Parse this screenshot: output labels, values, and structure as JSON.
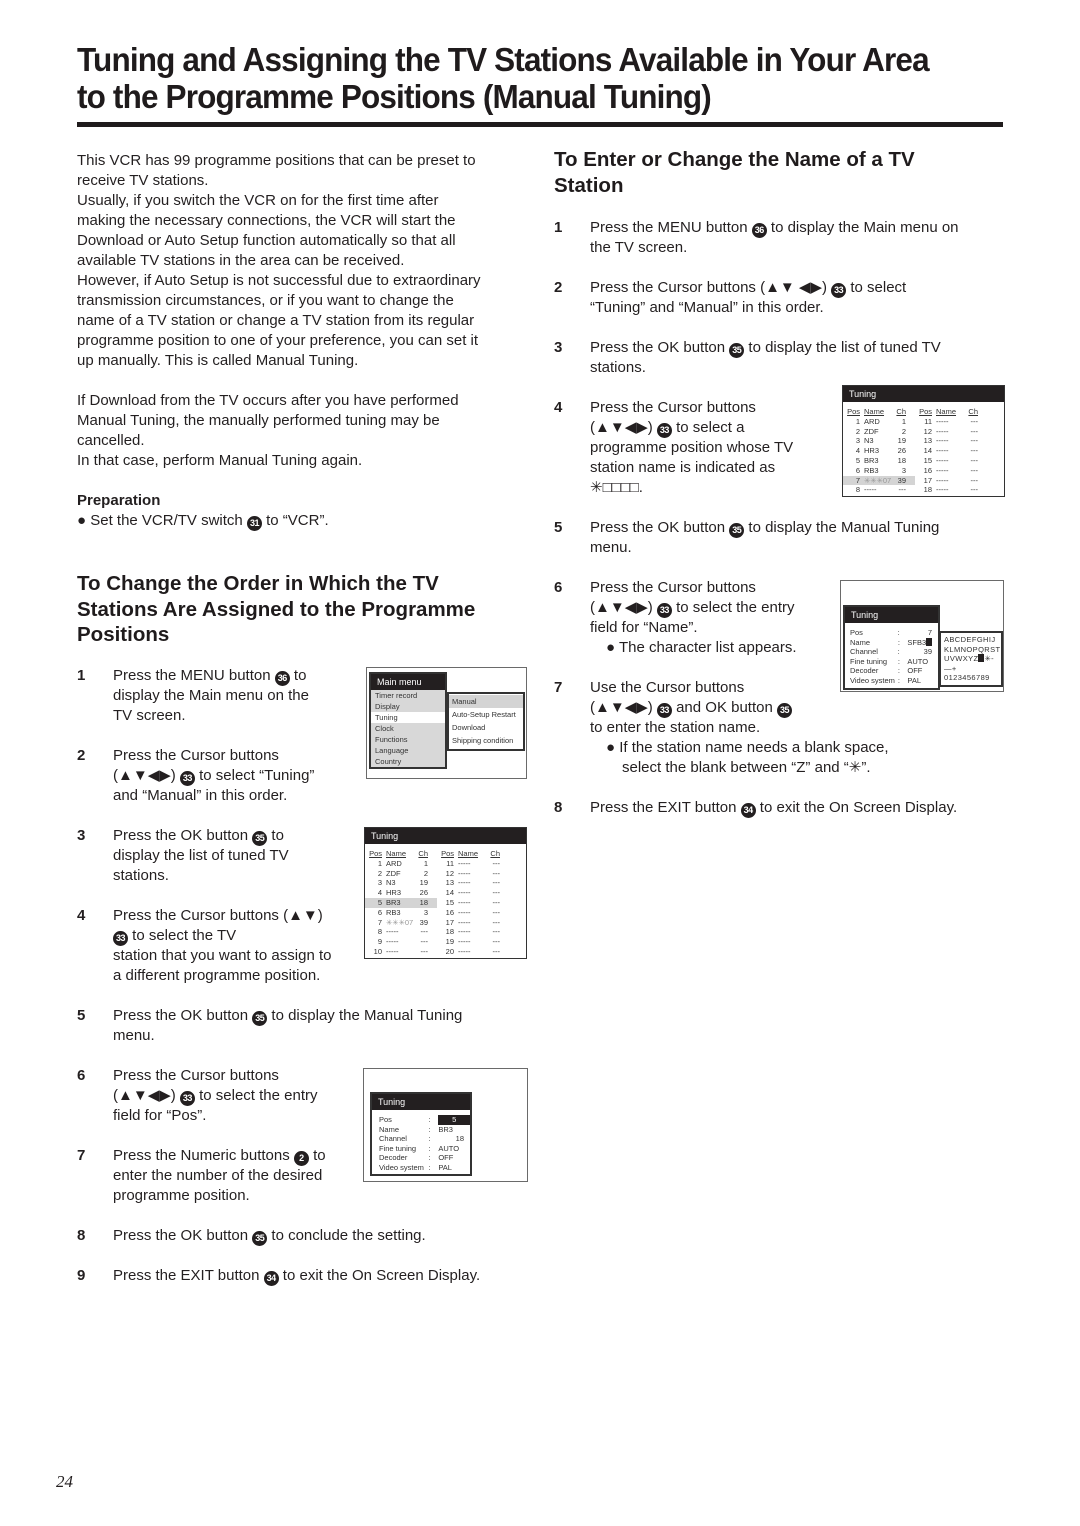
{
  "title": {
    "line1": "Tuning and Assigning the TV Stations Available in Your Area",
    "line2": "to the Programme Positions (Manual Tuning)"
  },
  "intro": {
    "p1_lines": [
      "This VCR has 99 programme positions that can be preset to",
      "receive TV stations.",
      "Usually, if you switch the VCR on for the first time after",
      "making the necessary connections, the VCR will start the",
      "Download or Auto Setup function automatically so that all",
      "available TV stations in the area can be received.",
      "However, if Auto Setup is not successful due to extraordinary",
      "transmission circumstances, or if you want to change the",
      "name of a TV station or change a TV station from its regular",
      "programme position to one of your preference, you can set it",
      "up manually. This is called Manual Tuning."
    ],
    "p2_lines": [
      "If Download from the TV occurs after you have performed",
      "Manual Tuning, the manually performed tuning may be",
      "cancelled.",
      "In that case, perform Manual Tuning again."
    ],
    "preparation_heading": "Preparation",
    "preparation_bullet_pre": "● Set the VCR/TV switch ",
    "preparation_badge": "31",
    "preparation_bullet_post": " to “VCR”."
  },
  "section_order": {
    "heading_lines": [
      "To Change the Order in Which the TV",
      "Stations Are Assigned to the Programme",
      "Positions"
    ],
    "steps": [
      {
        "num": "1",
        "lines": [
          "Press the MENU button ⑯ to",
          "display the Main menu on the",
          "TV screen."
        ]
      },
      {
        "num": "2",
        "lines": [
          "Press the Cursor buttons",
          "(▲▼◀▶) ⑬ to select “Tuning”",
          "and “Manual” in this order."
        ]
      },
      {
        "num": "3",
        "lines": [
          "Press the OK button ⑮ to",
          "display the list of tuned TV",
          "stations."
        ]
      },
      {
        "num": "4",
        "lines": [
          "Press the Cursor buttons (▲▼)",
          "⑬ to select the TV",
          "station that you want to assign to",
          "a different programme position."
        ]
      },
      {
        "num": "5",
        "lines": [
          "Press the OK button ⑮ to display the Manual Tuning",
          "menu."
        ]
      },
      {
        "num": "6",
        "lines": [
          "Press the Cursor buttons",
          "(▲▼◀▶) ⑬ to select the entry",
          "field for “Pos”."
        ]
      },
      {
        "num": "7",
        "lines": [
          "Press the Numeric buttons ❷ to",
          "enter the number of the desired",
          "programme position."
        ]
      },
      {
        "num": "8",
        "lines": [
          "Press the OK button ⑮ to conclude the setting."
        ]
      },
      {
        "num": "9",
        "lines": [
          "Press the EXIT button ⑭ to exit the On Screen Display."
        ]
      }
    ],
    "badges": {
      "menu": "36",
      "cursor": "33",
      "ok": "35",
      "exit": "34",
      "numeric": "2"
    }
  },
  "section_name": {
    "heading_lines": [
      "To Enter or Change the Name of a TV",
      "Station"
    ],
    "steps": [
      {
        "num": "1",
        "lines": [
          "Press the MENU button ⑯ to display the Main menu on",
          "the TV screen."
        ]
      },
      {
        "num": "2",
        "lines": [
          "Press the Cursor buttons (▲▼ ◀▶) ⑬ to select",
          "“Tuning” and “Manual” in this order."
        ]
      },
      {
        "num": "3",
        "lines": [
          "Press the OK button ⑮ to display the list of tuned TV",
          "stations."
        ]
      },
      {
        "num": "4",
        "lines": [
          "Press the Cursor buttons",
          "(▲▼◀▶) ⑬ to select a",
          "programme position whose TV",
          "station name is indicated as",
          "✳□□□□."
        ]
      },
      {
        "num": "5",
        "lines": [
          "Press the OK button ⑮ to display the Manual Tuning",
          "menu."
        ]
      },
      {
        "num": "6",
        "lines": [
          "Press the Cursor buttons",
          "(▲▼◀▶) ⑬ to select the entry",
          "field for “Name”."
        ],
        "bullet": "● The character list appears."
      },
      {
        "num": "7",
        "lines": [
          "Use the Cursor buttons",
          "(▲▼◀▶) ⑬ and OK button ⑮",
          "to enter the station name."
        ],
        "bullet_lines": [
          "● If the station name needs a blank space,",
          "select the blank between “Z” and “✳”."
        ]
      },
      {
        "num": "8",
        "lines": [
          "Press the EXIT button ⑭ to exit the On Screen Display."
        ]
      }
    ]
  },
  "osd_main_menu": {
    "header": "Main menu",
    "items": [
      "Timer record",
      "Display",
      "Tuning",
      "Clock",
      "Functions",
      "Language",
      "Country"
    ],
    "selected": "Tuning",
    "submenu": [
      "Manual",
      "Auto-Setup Restart",
      "Download",
      "Shipping condition"
    ],
    "submenu_selected": "Manual"
  },
  "osd_station_list": {
    "header": "Tuning",
    "columns": [
      "Pos",
      "Name",
      "Ch",
      "Pos",
      "Name",
      "Ch"
    ],
    "rows_left": [
      {
        "pos": "1",
        "name": "ARD",
        "ch": "1"
      },
      {
        "pos": "2",
        "name": "ZDF",
        "ch": "2"
      },
      {
        "pos": "3",
        "name": "N3",
        "ch": "19"
      },
      {
        "pos": "4",
        "name": "HR3",
        "ch": "26"
      },
      {
        "pos": "5",
        "name": "BR3",
        "ch": "18"
      },
      {
        "pos": "6",
        "name": "RB3",
        "ch": "3"
      },
      {
        "pos": "7",
        "name": "✳✳✳07",
        "ch": "39"
      },
      {
        "pos": "8",
        "name": "-----",
        "ch": "---"
      },
      {
        "pos": "9",
        "name": "-----",
        "ch": "---"
      },
      {
        "pos": "10",
        "name": "-----",
        "ch": "---"
      }
    ],
    "rows_right": [
      {
        "pos": "11",
        "name": "-----",
        "ch": "---"
      },
      {
        "pos": "12",
        "name": "-----",
        "ch": "---"
      },
      {
        "pos": "13",
        "name": "-----",
        "ch": "---"
      },
      {
        "pos": "14",
        "name": "-----",
        "ch": "---"
      },
      {
        "pos": "15",
        "name": "-----",
        "ch": "---"
      },
      {
        "pos": "16",
        "name": "-----",
        "ch": "---"
      },
      {
        "pos": "17",
        "name": "-----",
        "ch": "---"
      },
      {
        "pos": "18",
        "name": "-----",
        "ch": "---"
      },
      {
        "pos": "19",
        "name": "-----",
        "ch": "---"
      },
      {
        "pos": "20",
        "name": "-----",
        "ch": "---"
      }
    ],
    "highlight_left_list": "5",
    "highlight_right_list": "7"
  },
  "osd_manual_pos": {
    "header": "Tuning",
    "fields": [
      {
        "label": "Pos",
        "value": "5"
      },
      {
        "label": "Name",
        "value": "BR3"
      },
      {
        "label": "Channel",
        "value": "18"
      },
      {
        "label": "Fine tuning",
        "value": "AUTO"
      },
      {
        "label": "Decoder",
        "value": "OFF"
      },
      {
        "label": "Video system",
        "value": "PAL"
      }
    ]
  },
  "osd_manual_name": {
    "header": "Tuning",
    "fields": [
      {
        "label": "Pos",
        "value": "7"
      },
      {
        "label": "Name",
        "value": "SFB3"
      },
      {
        "label": "Channel",
        "value": "39"
      },
      {
        "label": "Fine tuning",
        "value": "AUTO"
      },
      {
        "label": "Decoder",
        "value": "OFF"
      },
      {
        "label": "Video system",
        "value": "PAL"
      }
    ],
    "charlist": [
      "ABCDEFGHIJ",
      "KLMNOPQRST",
      "UVWXYZ",
      "0123456789"
    ],
    "charlist_row3_tail": "✳-—+"
  },
  "page_number": "24"
}
